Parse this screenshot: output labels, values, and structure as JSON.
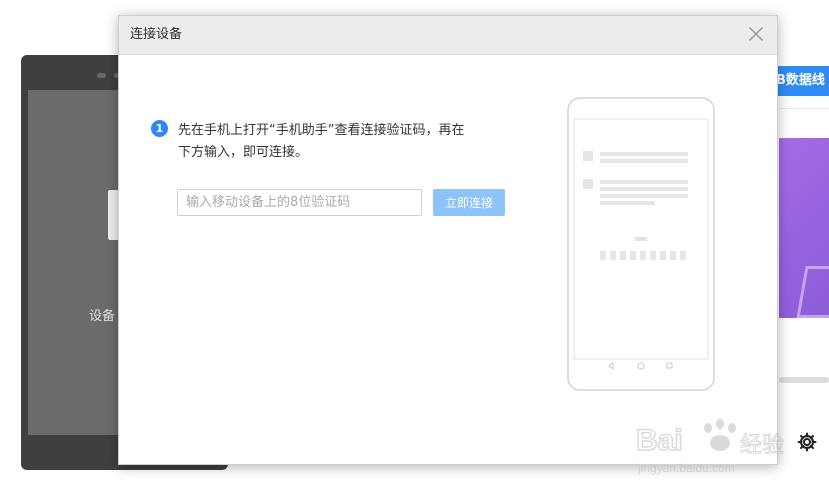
{
  "background": {
    "device_status_text": "设备",
    "tab_label": "B数据线",
    "gear_icon": "gear-icon"
  },
  "dialog": {
    "title": "连接设备",
    "close_icon": "close-icon",
    "step": {
      "number": "1",
      "line1": "先在手机上打开“手机助手”查看连接验证码，再在",
      "line2": "下方输入，即可连接。"
    },
    "code_input": {
      "placeholder": "输入移动设备上的8位验证码",
      "value": ""
    },
    "connect_button": "立即连接",
    "illustration": "phone-illustration"
  },
  "watermark": {
    "brand": "Bai",
    "brand_suffix": "经验",
    "url": "jingyan.baidu.com"
  },
  "colors": {
    "accent": "#2d89ef",
    "button_disabled": "#8cc3f8",
    "banner": "#a46ce5",
    "dialog_header": "#ececec"
  }
}
